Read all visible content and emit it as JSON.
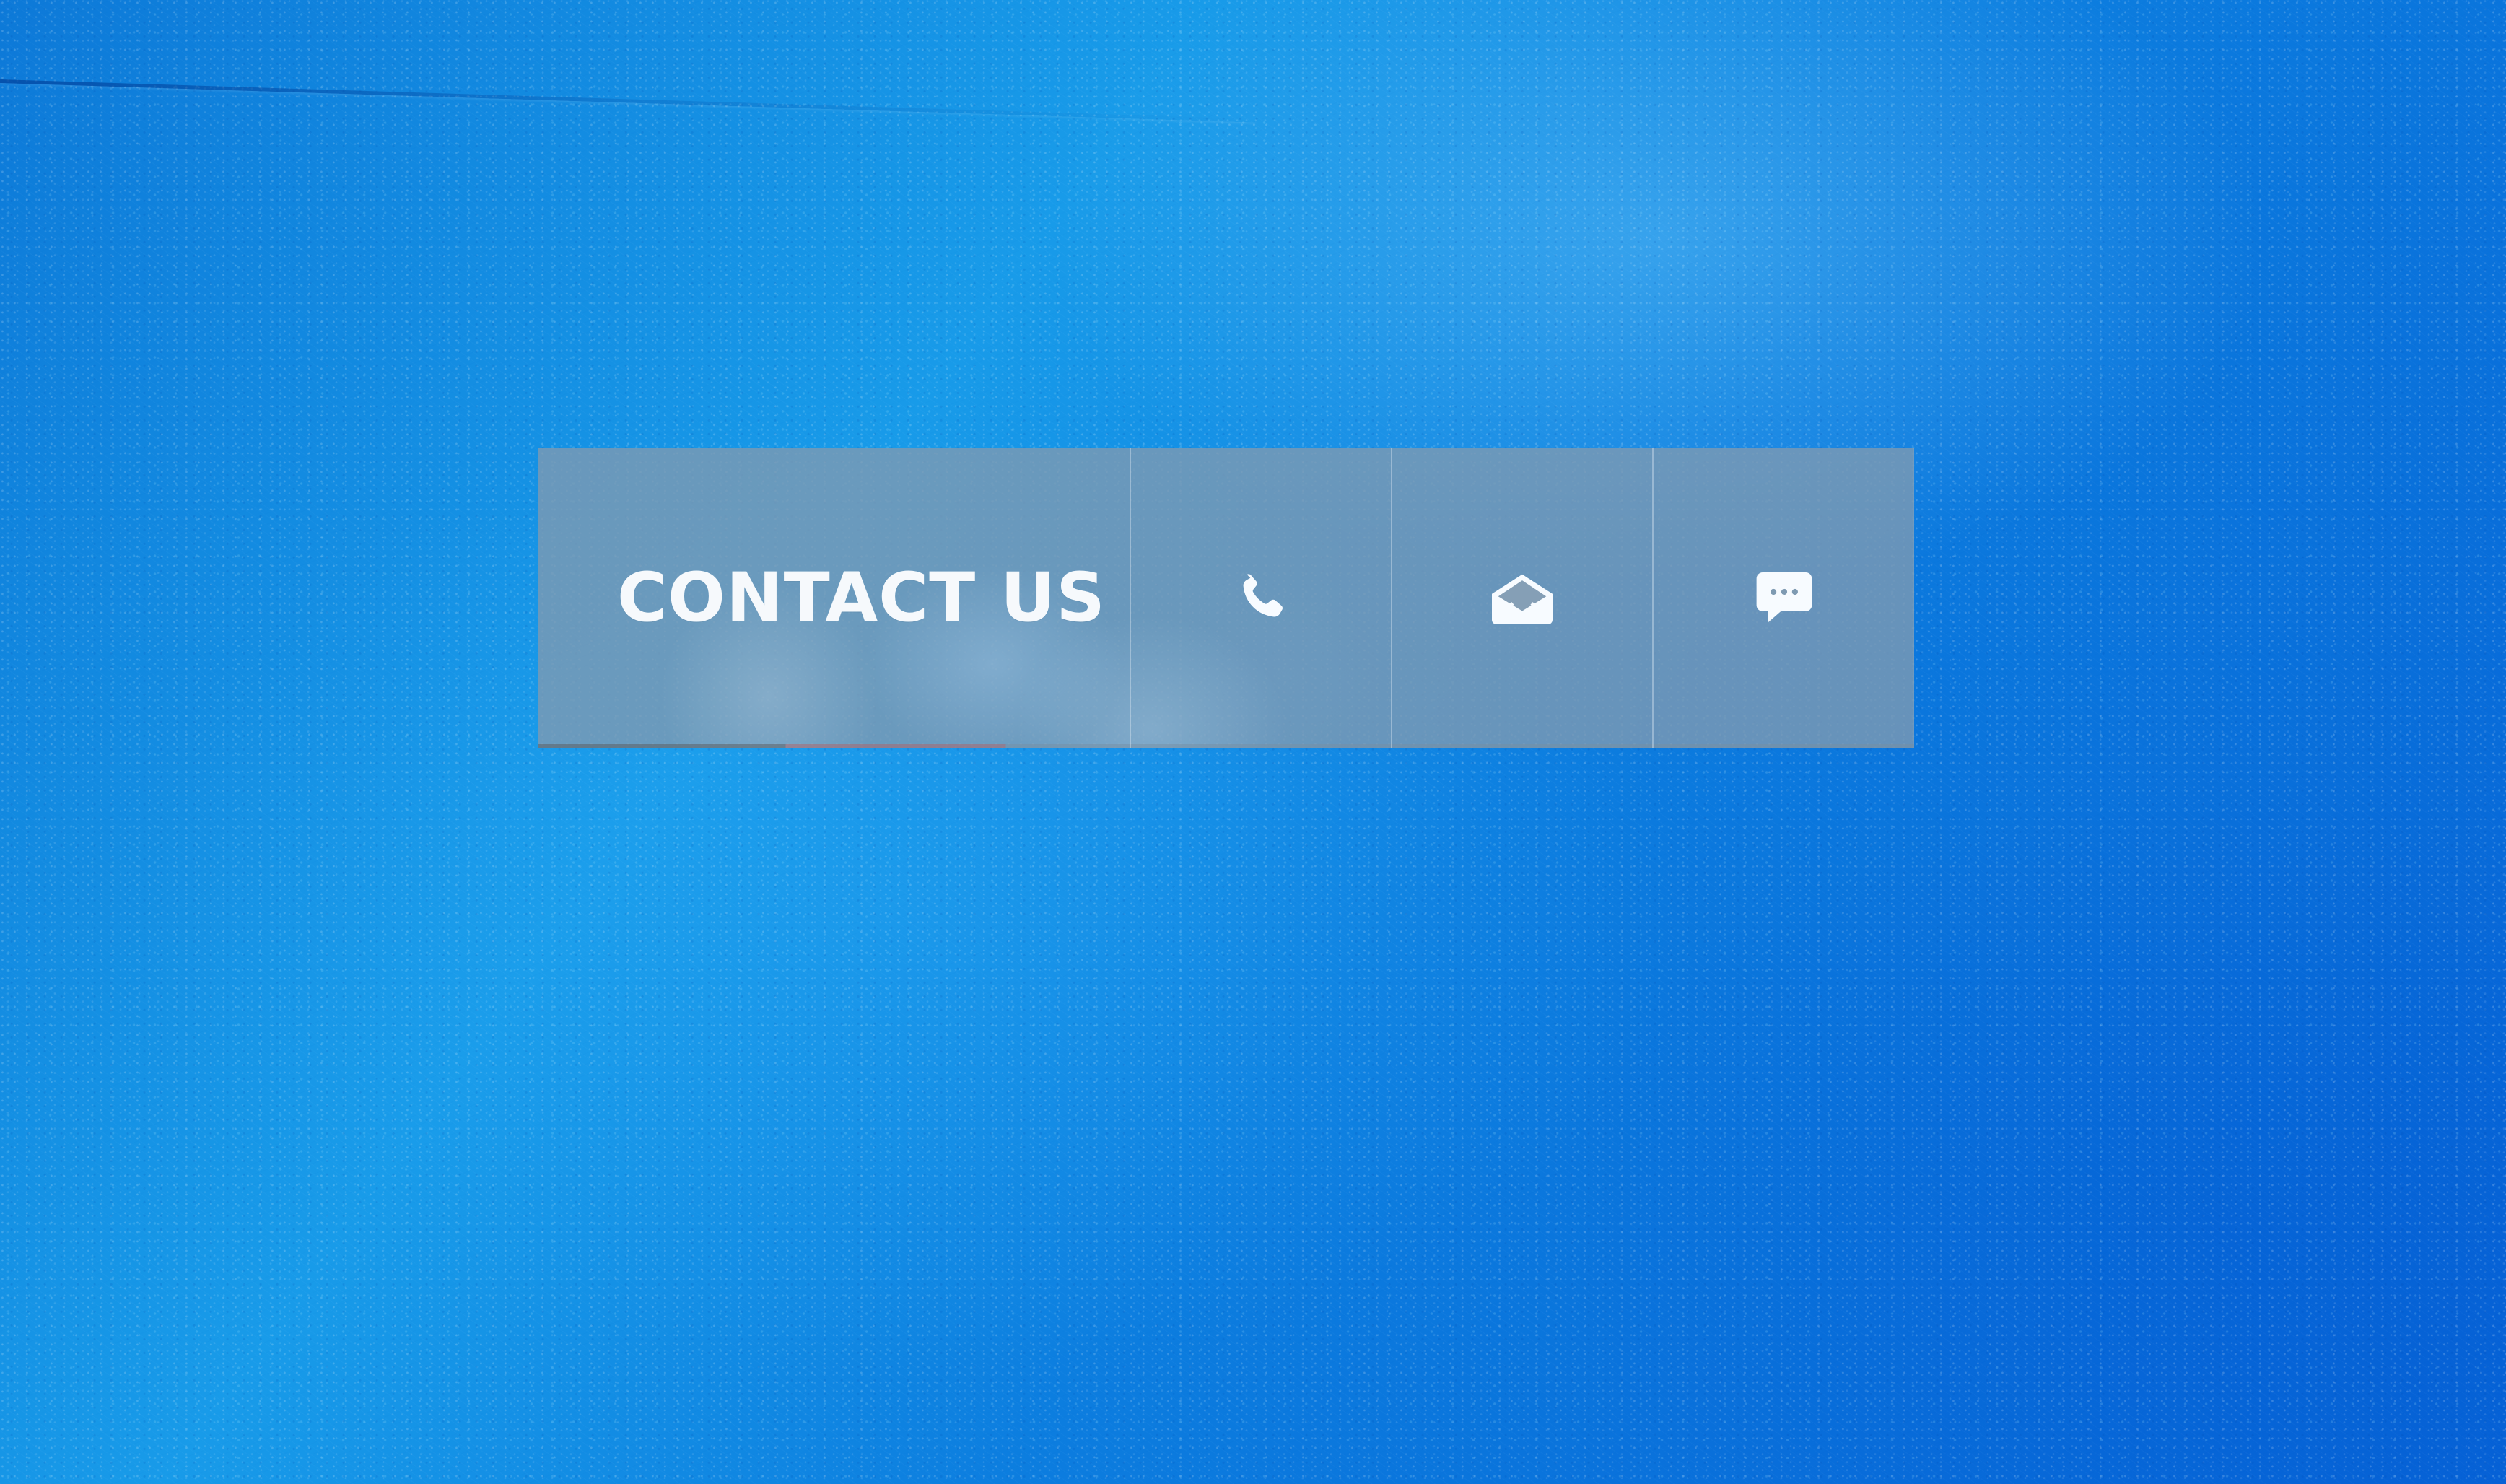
{
  "contact_widget": {
    "label": "CONTACT US",
    "actions": [
      {
        "icon": "phone-icon"
      },
      {
        "icon": "email-icon"
      },
      {
        "icon": "chat-icon"
      }
    ]
  },
  "colors": {
    "background": "#0f84e2",
    "widget_background": "#7e9ab2",
    "text": "#f6f9fc"
  }
}
